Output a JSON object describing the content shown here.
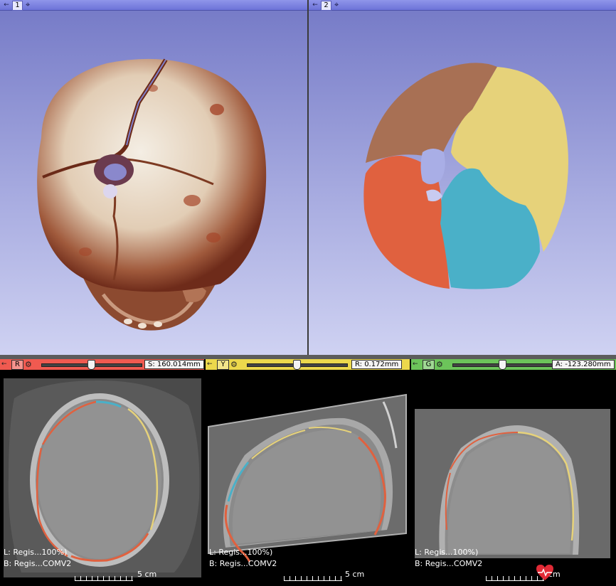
{
  "views": {
    "view1": {
      "label": "1"
    },
    "view2": {
      "label": "2"
    }
  },
  "slices": {
    "red": {
      "name": "R",
      "offset": "S: 160.014mm",
      "label_l": "L: Regis...100%)",
      "label_b": "B: Regis...COMV2",
      "scale": "5 cm",
      "slider_pos": 0.5,
      "color": "#f05a50"
    },
    "yellow": {
      "name": "Y",
      "offset": "R: 0.172mm",
      "label_l": "L: Regis...100%)",
      "label_b": "B: Regis...COMV2",
      "scale": "5 cm",
      "slider_pos": 0.5,
      "color": "#ecd84c"
    },
    "green": {
      "name": "G",
      "offset": "A: -123.280mm",
      "label_l": "L: Regis...100%)",
      "label_b": "B: Regis...COMV2",
      "scale": "cm",
      "slider_pos": 0.5,
      "color": "#6cc45a"
    }
  },
  "segment_colors": {
    "red": "#e0613f",
    "yellow": "#e6d27a",
    "blue": "#4ab0c8",
    "brown": "#a87054"
  },
  "icons": {
    "pin": "pin-icon",
    "crosshair": "crosshair-icon",
    "gear": "gear-icon",
    "watermark": "heart-logo-icon"
  }
}
